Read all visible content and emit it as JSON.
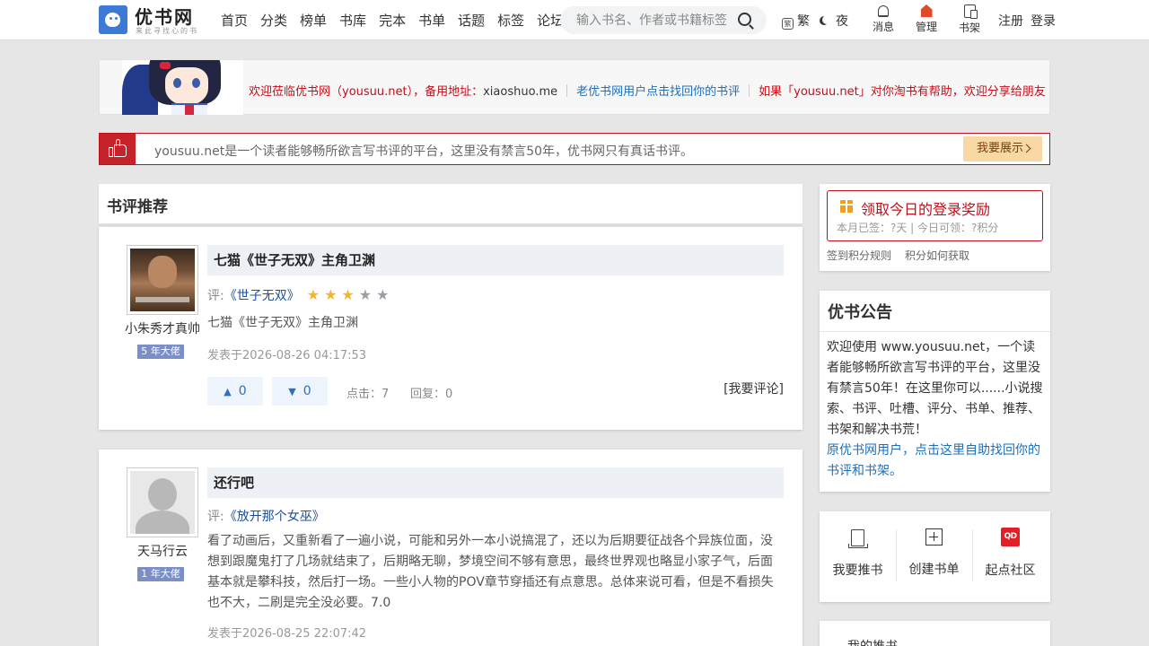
{
  "header": {
    "logo_text": "优书网",
    "logo_slogan": "来此寻找心的书",
    "nav": [
      "首页",
      "分类",
      "榜单",
      "书库",
      "完本",
      "书单",
      "话题",
      "标签",
      "论坛"
    ],
    "search_placeholder": "输入书名、作者或书籍标签",
    "traditional_label": "繁",
    "trad_icon_char": "繁",
    "night_label": "夜",
    "messages_label": "消息",
    "manage_label": "管理",
    "shelf_label": "书架",
    "register_label": "注册",
    "login_label": "登录"
  },
  "welcome": {
    "text1": "欢迎莅临优书网（yousuu.net），备用地址：",
    "alt_domain": "xiaoshuo.me",
    "old_user_link": "老优书网用户点击找回你的书评",
    "share_text": "如果「yousuu.net」对你淘书有帮助，欢迎分享给朋友"
  },
  "notice": {
    "text": "yousuu.net是一个读者能够畅所欲言写书评的平台，这里没有禁言50年，优书网只有真话书评。",
    "button": "我要展示"
  },
  "main": {
    "section_title": "书评推荐",
    "reviews": [
      {
        "username": "小朱秀才真帅",
        "level": "5 年大佬",
        "title": "七猫《世子无双》主角卫渊",
        "prefix": "评:",
        "book": "《世子无双》",
        "rating": 3,
        "body": "七猫《世子无双》主角卫渊",
        "date": "发表于2026-08-26 04:17:53",
        "upvotes": "0",
        "downvotes": "0",
        "clicks": "点击：7",
        "replies": "回复：0",
        "comment_label": "[我要评论]"
      },
      {
        "username": "天马行云",
        "level": "1 年大佬",
        "title": "还行吧",
        "prefix": "评:",
        "book": "《放开那个女巫》",
        "body": "看了动画后，又重新看了一遍小说，可能和另外一本小说搞混了，还以为后期要征战各个异族位面，没想到跟魔鬼打了几场就结束了，后期略无聊，梦境空间不够有意思，最终世界观也略显小家子气，后面基本就是攀科技，然后打一场。一些小人物的POV章节穿插还有点意思。总体来说可看，但是不看损失也不大，二刷是完全没必要。7.0",
        "date": "发表于2026-08-25 22:07:42"
      }
    ]
  },
  "sidebar": {
    "reward_title": "领取今日的登录奖励",
    "reward_sub": "本月已签：?天 | 今日可领：?积分",
    "link_rules": "签到积分规则",
    "link_points": "积分如何获取",
    "announce_title": "优书公告",
    "announce_text": "欢迎使用 www.yousuu.net，一个读者能够畅所欲言写书评的平台，这里没有禁言50年！在这里你可以......小说搜索、书评、吐槽、评分、书单、推荐、书架和解决书荒！",
    "announce_link": "原优书网用户，点击这里自助找回你的书评和书架。",
    "actions": [
      "我要推书",
      "创建书单",
      "起点社区"
    ],
    "qd_icon_text": "QD",
    "my_rec": "我的推书"
  },
  "colors": {
    "accent_red": "#c40e1a",
    "link_blue": "#1f6fb8",
    "star_on": "#f1b62b",
    "badge": "#7b8ec6"
  }
}
